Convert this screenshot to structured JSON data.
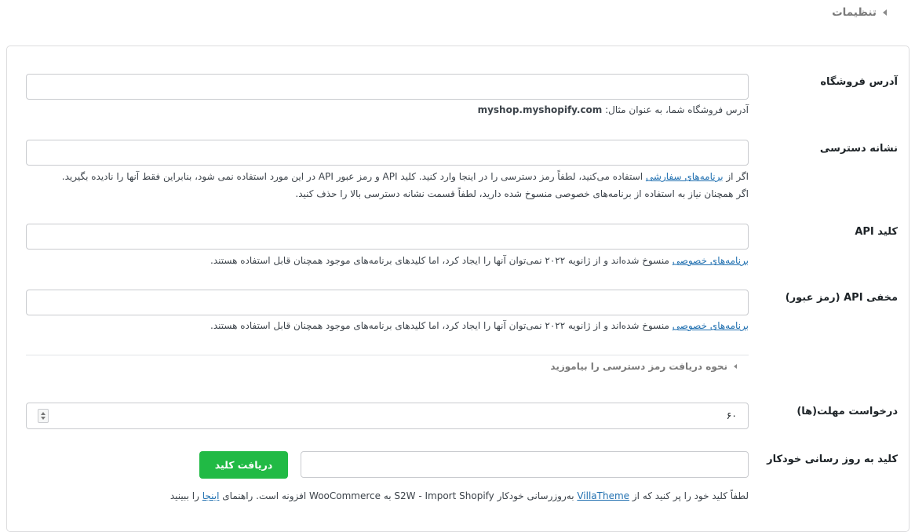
{
  "header": {
    "title": "تنظیمات"
  },
  "fields": {
    "store_address": {
      "label": "آدرس فروشگاه",
      "value": "",
      "desc_text": "آدرس فروشگاه شما، به عنوان مثال: ",
      "desc_example": "myshop.myshopify.com"
    },
    "access_token": {
      "label": "نشانه دسترسی",
      "value": "",
      "desc_line1_prefix": "اگر از ",
      "desc_line1_link": "برنامه‌های سفارشی",
      "desc_line1_suffix": " استفاده می‌کنید، لطفاً رمز دسترسی را در اینجا وارد کنید. کلید API و رمز عبور API در این مورد استفاده نمی شود، بنابراین فقط آنها را نادیده بگیرید.",
      "desc_line2": "اگر همچنان نیاز به استفاده از برنامه‌های خصوصی منسوخ شده دارید، لطفاً قسمت نشانه دسترسی بالا را حذف کنید."
    },
    "api_key": {
      "label": "کلید API",
      "value": "",
      "desc_link": "برنامه‌های خصوصی",
      "desc_suffix": " منسوخ شده‌اند و از ژانویه ۲۰۲۲ نمی‌توان آنها را ایجاد کرد، اما کلیدهای برنامه‌های موجود همچنان قابل استفاده هستند."
    },
    "api_secret": {
      "label": "مخفی API (رمز عبور)",
      "value": "",
      "desc_link": "برنامه‌های خصوصی",
      "desc_suffix": " منسوخ شده‌اند و از ژانویه ۲۰۲۲ نمی‌توان آنها را ایجاد کرد، اما کلیدهای برنامه‌های موجود همچنان قابل استفاده هستند."
    },
    "learn_token": {
      "label": "نحوه دریافت رمز دسترسی را بیاموزید"
    },
    "timeout": {
      "label": "درخواست مهلت(ها)",
      "value": "۶۰"
    },
    "auto_update_key": {
      "label": "کلید به روز رسانی خودکار",
      "value": "",
      "button_label": "دریافت کلید",
      "desc_prefix": "لطفاً کلید خود را پر کنید که از ",
      "desc_link": "VillaTheme",
      "desc_middle": " به‌روزرسانی خودکار S2W - Import Shopify به WooCommerce افزونه است. راهنمای ",
      "desc_link2": "اینجا",
      "desc_suffix": " را ببینید"
    }
  },
  "colors": {
    "link": "#2271b1",
    "button": "#21ba45",
    "border": "#c9cbcf"
  },
  "icons": {
    "header_caret": "caret-left-icon",
    "accordion_caret": "caret-left-icon",
    "spinner": "spinner-icon"
  }
}
